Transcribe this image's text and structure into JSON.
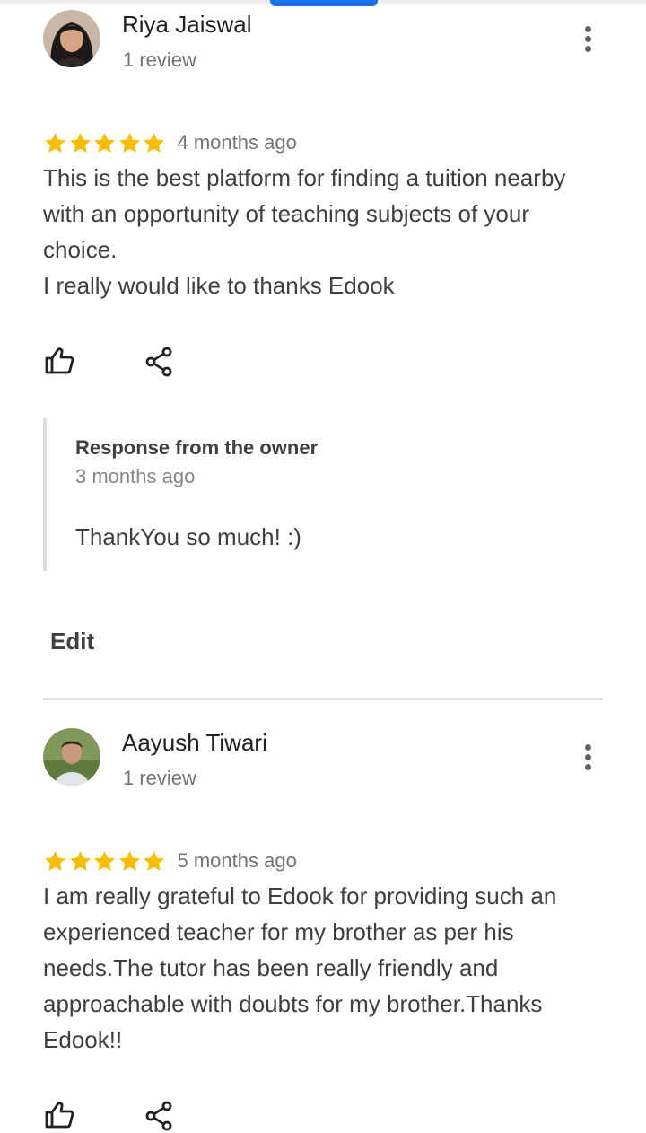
{
  "reviews": [
    {
      "name": "Riya Jaiswal",
      "review_count": "1 review",
      "rating": 5,
      "time": "4 months ago",
      "text": "This is the best platform for finding a tuition nearby with an opportunity of teaching subjects of your choice.\nI really would like to thanks Edook",
      "owner_response": {
        "title": "Response from the owner",
        "time": "3 months ago",
        "text": "ThankYou so much! :)"
      },
      "edit_label": "Edit"
    },
    {
      "name": "Aayush Tiwari",
      "review_count": "1 review",
      "rating": 5,
      "time": "5 months ago",
      "text": "I am really grateful to Edook for providing such an experienced teacher for my brother as per his needs.The tutor has been really friendly and approachable with doubts for my brother.Thanks Edook!!"
    }
  ],
  "colors": {
    "star": "#fbbc04",
    "accent_tab": "#1a73e8",
    "divider": "#e0e0e0"
  },
  "icons": {
    "like": "thumb-up-outline-icon",
    "share": "share-icon",
    "more": "more-vertical-icon"
  }
}
